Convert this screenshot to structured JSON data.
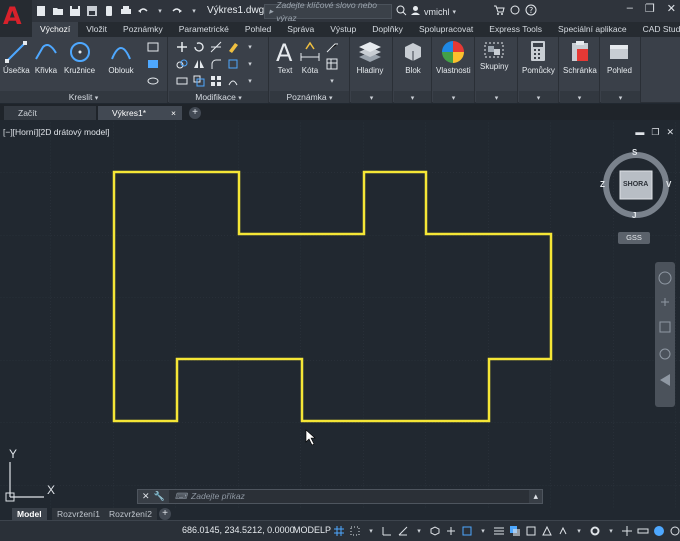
{
  "app": {
    "logo_letter": "A",
    "document_title": "Výkres1.dwg",
    "search_placeholder": "Zadejte klíčové slovo nebo výraz",
    "username": "vmichl",
    "accent_color": "#d8212b"
  },
  "ribbon_tabs": [
    {
      "label": "Výchozí",
      "active": true
    },
    {
      "label": "Vložit"
    },
    {
      "label": "Poznámky"
    },
    {
      "label": "Parametrické"
    },
    {
      "label": "Pohled"
    },
    {
      "label": "Správa"
    },
    {
      "label": "Výstup"
    },
    {
      "label": "Doplňky"
    },
    {
      "label": "Spolupracovat"
    },
    {
      "label": "Express Tools"
    },
    {
      "label": "Speciální aplikace"
    },
    {
      "label": "CAD Studio"
    }
  ],
  "ribbon": {
    "draw": {
      "title": "Kreslit",
      "line": "Úsečka",
      "polyline": "Křivka",
      "circle": "Kružnice",
      "arc": "Oblouk"
    },
    "modify": {
      "title": "Modifikace"
    },
    "annotation": {
      "title": "Poznámka",
      "text": "Text",
      "dimension": "Kóta"
    },
    "layers": {
      "label": "Hladiny"
    },
    "block": {
      "label": "Blok"
    },
    "properties": {
      "label": "Vlastnosti"
    },
    "groups": {
      "label": "Skupiny"
    },
    "utilities": {
      "label": "Pomůcky"
    },
    "clipboard": {
      "label": "Schránka"
    },
    "view": {
      "label": "Pohled"
    }
  },
  "file_tabs": [
    {
      "label": "Začít"
    },
    {
      "label": "Výkres1*",
      "active": true
    }
  ],
  "viewport": {
    "label": "[−][Horní][2D drátový model]",
    "viewcube": {
      "north": "S",
      "south": "J",
      "east": "V",
      "west": "Z",
      "face": "SHORA"
    },
    "wcs_label": "GSS",
    "ucs_x": "X",
    "ucs_y": "Y",
    "drawing_color": "#f5e636"
  },
  "command_line": {
    "placeholder": "Zadejte příkaz"
  },
  "layout_tabs": [
    {
      "label": "Model",
      "active": true
    },
    {
      "label": "Rozvržení1"
    },
    {
      "label": "Rozvržení2"
    }
  ],
  "status_bar": {
    "coordinates": "686.0145, 234.5212, 0.0000",
    "model_label": "MODELP"
  }
}
